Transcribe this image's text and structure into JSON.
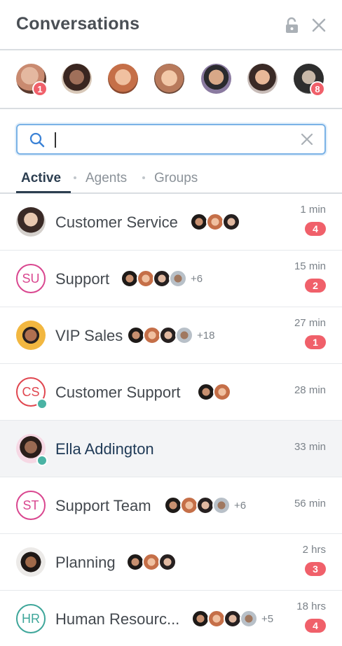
{
  "header": {
    "title": "Conversations",
    "lock_icon": "unlock-icon",
    "close_icon": "close-icon"
  },
  "avatar_strip": [
    {
      "name": "agent-1",
      "badge": "1",
      "color": "#c98a70"
    },
    {
      "name": "agent-2",
      "badge": "",
      "color": "#7a4e3e"
    },
    {
      "name": "agent-3",
      "badge": "",
      "color": "#c56f48"
    },
    {
      "name": "agent-4",
      "badge": "",
      "color": "#b87a5c"
    },
    {
      "name": "agent-5",
      "badge": "",
      "color": "#6a5a6e"
    },
    {
      "name": "agent-6",
      "badge": "",
      "color": "#8c6a5a"
    },
    {
      "name": "agent-7",
      "badge": "8",
      "color": "#2e2e2e"
    }
  ],
  "search": {
    "value": "",
    "placeholder": ""
  },
  "tabs": [
    {
      "label": "Active",
      "active": true
    },
    {
      "label": "Agents",
      "active": false
    },
    {
      "label": "Groups",
      "active": false
    }
  ],
  "conversations": [
    {
      "name": "Customer Service",
      "time": "1 min",
      "unread": "4",
      "more": ""
    },
    {
      "name": "Support",
      "initials": "SU",
      "time": "15 min",
      "unread": "2",
      "more": "+6"
    },
    {
      "name": "VIP Sales",
      "time": "27 min",
      "unread": "1",
      "more": "+18"
    },
    {
      "name": "Customer Support",
      "initials": "CS",
      "time": "28 min",
      "unread": "",
      "more": ""
    },
    {
      "name": "Ella Addington",
      "time": "33 min",
      "unread": "",
      "more": ""
    },
    {
      "name": "Support Team",
      "initials": "ST",
      "time": "56 min",
      "unread": "",
      "more": "+6"
    },
    {
      "name": "Planning",
      "time": "2 hrs",
      "unread": "3",
      "more": ""
    },
    {
      "name": "Human Resourc...",
      "initials": "HR",
      "time": "18 hrs",
      "unread": "4",
      "more": "+5"
    }
  ],
  "colors": {
    "badge": "#f0606a",
    "online": "#4ab3a4",
    "search_border": "#7ab2e6",
    "su": "#d9468f",
    "cs": "#e0464f",
    "hr": "#3ea69a"
  }
}
